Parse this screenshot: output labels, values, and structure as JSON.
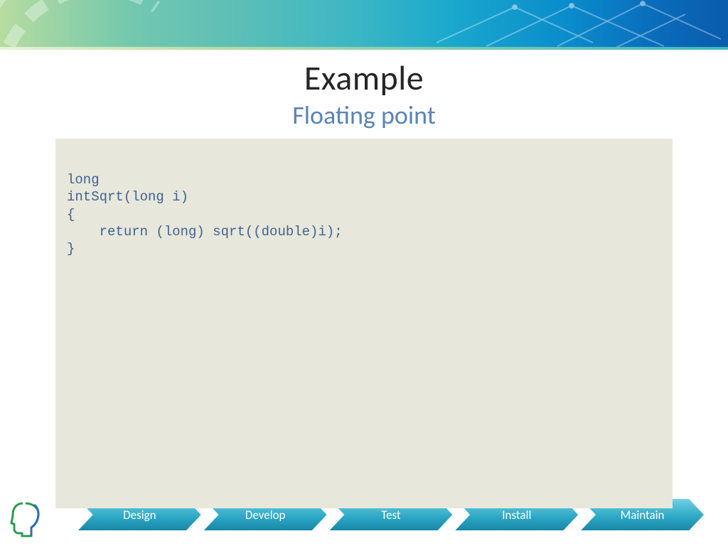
{
  "title": "Example",
  "subtitle": "Floating point",
  "code": "long\nintSqrt(long i)\n{\n    return (long) sqrt((double)i);\n}",
  "footer_steps": [
    "Design",
    "Develop",
    "Test",
    "Install",
    "Maintain"
  ]
}
